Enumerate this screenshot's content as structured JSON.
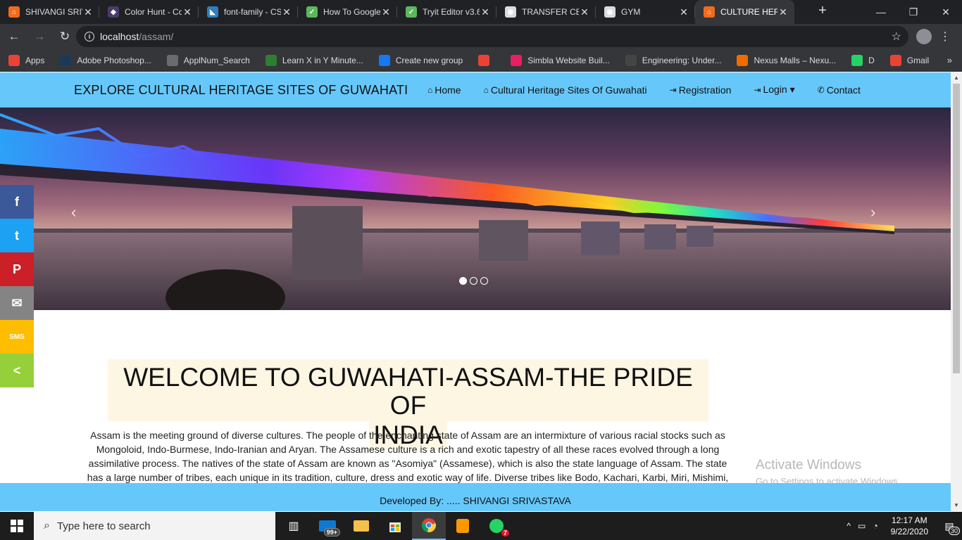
{
  "browser": {
    "tabs": [
      {
        "title": "SHIVANGI SRIVASTAVA",
        "color": "#f26b1d",
        "glyph": "⌂"
      },
      {
        "title": "Color Hunt - Color Palettes",
        "color": "#4a3b6b",
        "glyph": "◆"
      },
      {
        "title": "font-family - CSS",
        "color": "#2f7fbf",
        "glyph": "◣"
      },
      {
        "title": "How To Google Fonts",
        "color": "#5cb85c",
        "glyph": "✓"
      },
      {
        "title": "Tryit Editor v3.6",
        "color": "#5cb85c",
        "glyph": "✓"
      },
      {
        "title": "TRANSFER CERTIFICATE",
        "color": "#dadce0",
        "glyph": "◉"
      },
      {
        "title": "GYM",
        "color": "#dadce0",
        "glyph": "◉"
      },
      {
        "title": "CULTURE HERITAGE",
        "color": "#f26b1d",
        "glyph": "⌂",
        "active": true
      }
    ],
    "url_host": "localhost",
    "url_path": "/assam/",
    "bookmarks": [
      {
        "label": "Apps",
        "color": "#ea4335"
      },
      {
        "label": "Adobe Photoshop...",
        "color": "#1b3a57"
      },
      {
        "label": "ApplNum_Search",
        "color": "#6b6b6b"
      },
      {
        "label": "Learn X in Y Minute...",
        "color": "#2e7d32"
      },
      {
        "label": "Create new group",
        "color": "#1877f2"
      },
      {
        "label": "",
        "color": "#ea4335"
      },
      {
        "label": "Simbla Website Buil...",
        "color": "#e91e63"
      },
      {
        "label": "Engineering: Under...",
        "color": "#444444"
      },
      {
        "label": "Nexus Malls – Nexu...",
        "color": "#ef6c00"
      },
      {
        "label": "D",
        "color": "#25d366"
      },
      {
        "label": "Gmail",
        "color": "#ea4335"
      }
    ]
  },
  "site": {
    "brand": "EXPLORE CULTURAL HERITAGE SITES OF GUWAHATI",
    "nav": [
      {
        "label": "Home",
        "icon": "⌂"
      },
      {
        "label": "Cultural Heritage Sites Of Guwahati",
        "icon": "⌂"
      },
      {
        "label": "Registration",
        "icon": "⇥"
      },
      {
        "label": "Login ▾",
        "icon": "⇥"
      },
      {
        "label": "Contact",
        "icon": "✆"
      }
    ],
    "carousel": {
      "prev": "‹",
      "next": "›",
      "slides": 3,
      "active_slide": 1
    },
    "share": [
      {
        "name": "facebook",
        "glyph": "f",
        "color": "#3b5998"
      },
      {
        "name": "twitter",
        "glyph": "t",
        "color": "#1da1f2"
      },
      {
        "name": "pinterest",
        "glyph": "P",
        "color": "#cb2027"
      },
      {
        "name": "email",
        "glyph": "✉",
        "color": "#848484"
      },
      {
        "name": "sms",
        "glyph": "SMS",
        "color": "#ffbd00"
      },
      {
        "name": "sharethis",
        "glyph": "<",
        "color": "#95d03a"
      }
    ],
    "welcome_line1": "WELCOME TO GUWAHATI-ASSAM-THE PRIDE OF",
    "welcome_line2": "INDIA",
    "paragraph": "Assam is the meeting ground of diverse cultures. The people of the enchanting state of Assam are an intermixture of various racial stocks such as Mongoloid, Indo-Burmese, Indo-Iranian and Aryan. The Assamese culture is a rich and exotic tapestry of all these races evolved through a long assimilative process. The natives of the state of Assam are known as \"Asomiya\" (Assamese), which is also the state language of Assam. The state has a large number of tribes, each unique in its tradition, culture, dress and exotic way of life. Diverse tribes like Bodo, Kachari, Karbi, Miri, Mishimi,",
    "footer": "Developed By: ..... SHIVANGI SRIVASTAVA"
  },
  "watermark": {
    "line1": "Activate Windows",
    "line2": "Go to Settings to activate Windows."
  },
  "taskbar": {
    "search_placeholder": "Type here to search",
    "mail_badge": "99+",
    "whatsapp_badge": "7",
    "time": "12:17 AM",
    "date": "9/22/2020",
    "notification_count": "30"
  }
}
